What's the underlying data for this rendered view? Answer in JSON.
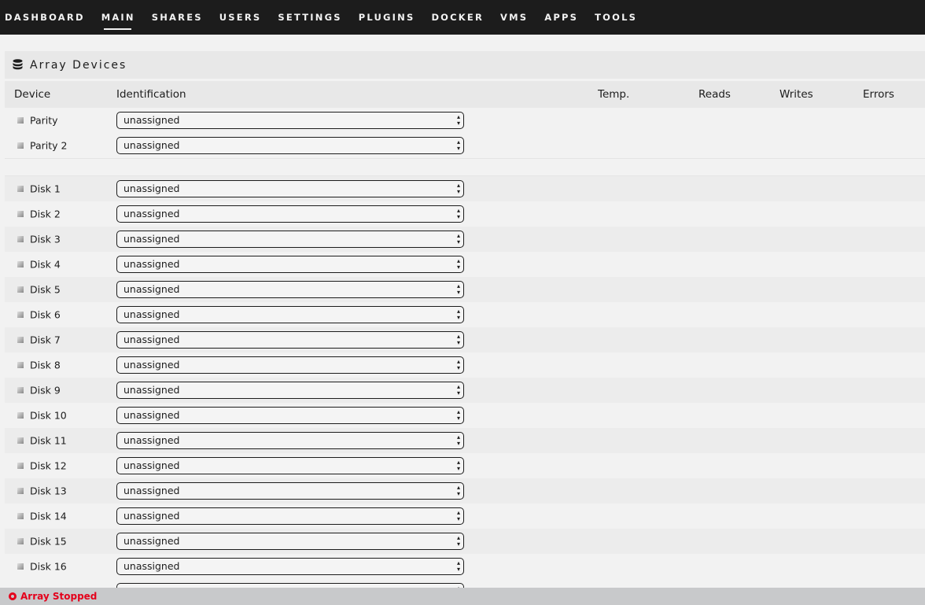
{
  "nav": [
    "DASHBOARD",
    "MAIN",
    "SHARES",
    "USERS",
    "SETTINGS",
    "PLUGINS",
    "DOCKER",
    "VMS",
    "APPS",
    "TOOLS"
  ],
  "active_tab": "MAIN",
  "section_title": "Array Devices",
  "columns": {
    "device": "Device",
    "identification": "Identification",
    "temp": "Temp.",
    "reads": "Reads",
    "writes": "Writes",
    "errors": "Errors"
  },
  "parity": [
    {
      "name": "Parity",
      "value": "unassigned"
    },
    {
      "name": "Parity 2",
      "value": "unassigned"
    }
  ],
  "disks": [
    {
      "name": "Disk 1",
      "value": "unassigned"
    },
    {
      "name": "Disk 2",
      "value": "unassigned"
    },
    {
      "name": "Disk 3",
      "value": "unassigned"
    },
    {
      "name": "Disk 4",
      "value": "unassigned"
    },
    {
      "name": "Disk 5",
      "value": "unassigned"
    },
    {
      "name": "Disk 6",
      "value": "unassigned"
    },
    {
      "name": "Disk 7",
      "value": "unassigned"
    },
    {
      "name": "Disk 8",
      "value": "unassigned"
    },
    {
      "name": "Disk 9",
      "value": "unassigned"
    },
    {
      "name": "Disk 10",
      "value": "unassigned"
    },
    {
      "name": "Disk 11",
      "value": "unassigned"
    },
    {
      "name": "Disk 12",
      "value": "unassigned"
    },
    {
      "name": "Disk 13",
      "value": "unassigned"
    },
    {
      "name": "Disk 14",
      "value": "unassigned"
    },
    {
      "name": "Disk 15",
      "value": "unassigned"
    },
    {
      "name": "Disk 16",
      "value": "unassigned"
    }
  ],
  "status": {
    "text": "Array Stopped",
    "color": "#e4001b"
  }
}
